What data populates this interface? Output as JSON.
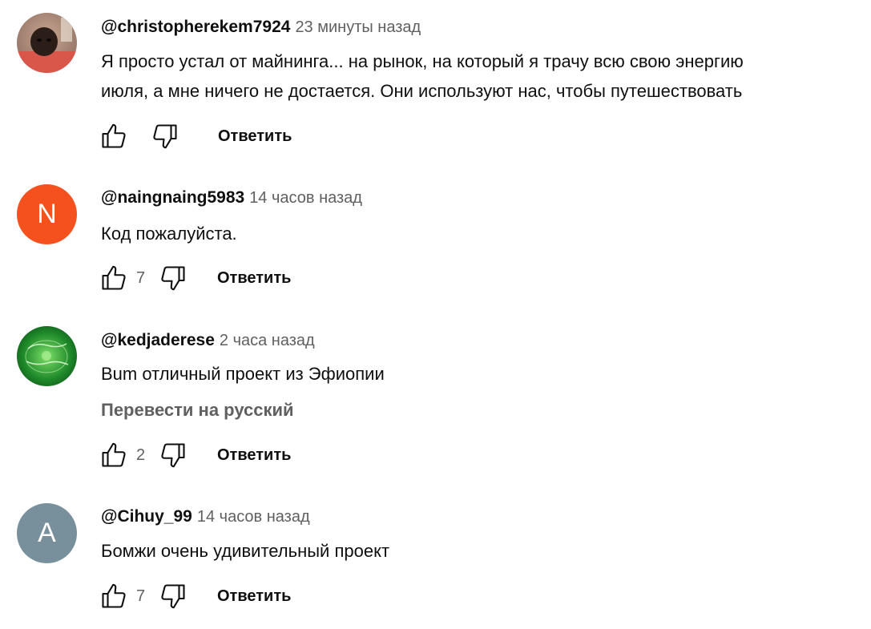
{
  "comments": [
    {
      "author": "@christopherekem7924",
      "time": "23 минуты назад",
      "text_lines": [
        "Я просто устал от майнинга... на рынок, на который я трачу всю свою энергию",
        "июля, а мне ничего не достается. Они используют нас, чтобы путешествовать"
      ],
      "likes": "",
      "reply_label": "Ответить",
      "avatar": {
        "type": "photo",
        "icon": "person-photo"
      }
    },
    {
      "author": "@naingnaing5983",
      "time": "14 часов назад",
      "text_lines": [
        "Код пожалуйста."
      ],
      "likes": "7",
      "reply_label": "Ответить",
      "avatar": {
        "type": "letter",
        "letter": "N",
        "color": "#f4511e"
      }
    },
    {
      "author": "@kedjaderese",
      "time": "2 часа назад",
      "text_lines": [
        "Bum отличный проект из Эфиопии"
      ],
      "translate_label": "Перевести на русский",
      "likes": "2",
      "reply_label": "Ответить",
      "avatar": {
        "type": "photo",
        "icon": "green-logo"
      }
    },
    {
      "author": "@Cihuy_99",
      "time": "14 часов назад",
      "text_lines": [
        "Бомжи очень удивительный проект"
      ],
      "likes": "7",
      "reply_label": "Ответить",
      "avatar": {
        "type": "letter",
        "letter": "A",
        "color": "#78909c"
      }
    }
  ],
  "icons": {
    "like": "thumb-up-outline",
    "dislike": "thumb-down-outline"
  },
  "colors": {
    "text_primary": "#0f0f0f",
    "text_secondary": "#606060"
  }
}
